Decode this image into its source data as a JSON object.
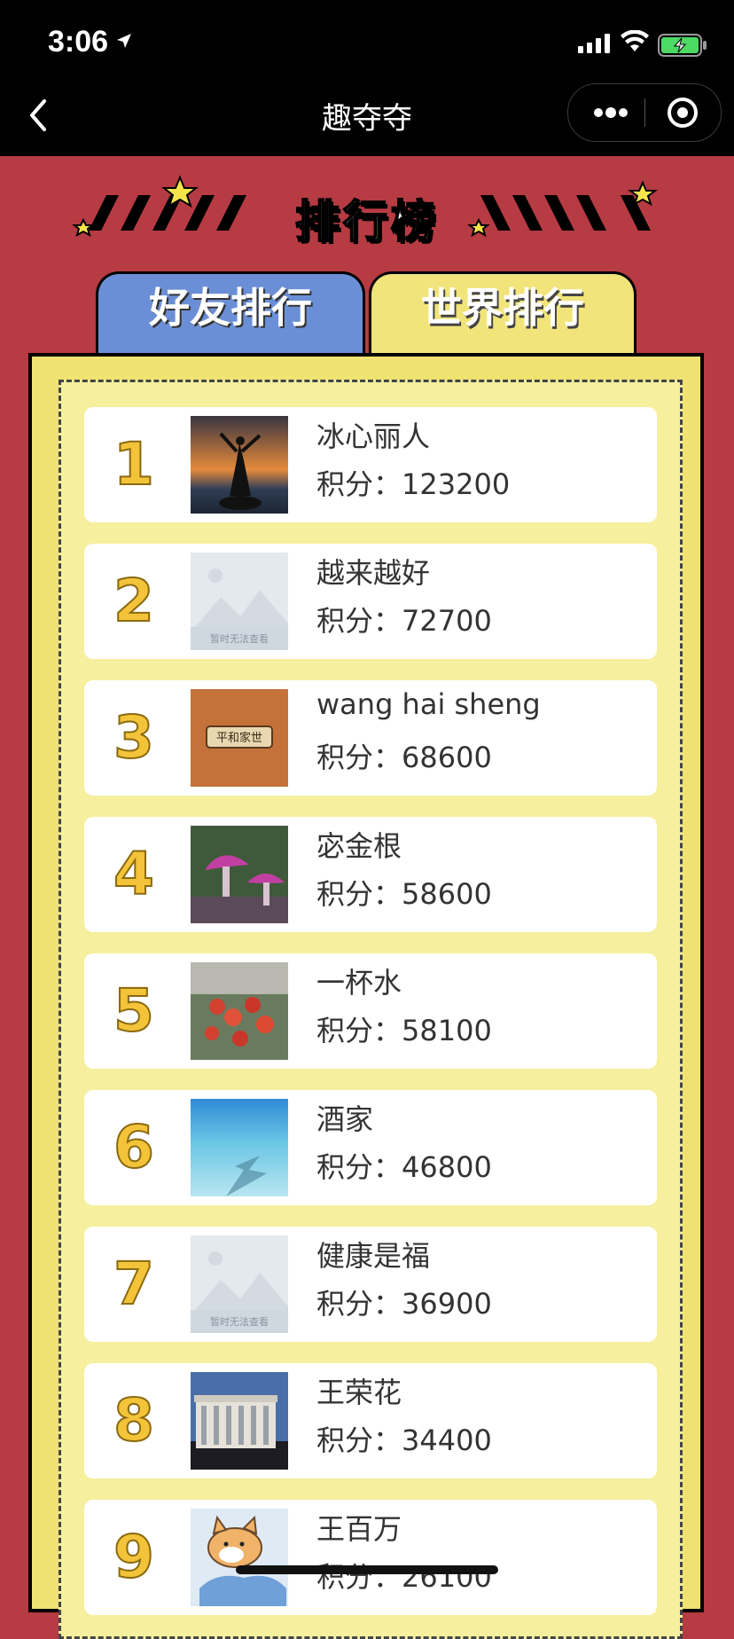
{
  "status": {
    "time": "3:06"
  },
  "nav": {
    "title": "趣夺夺"
  },
  "banner": {
    "title": "排行榜"
  },
  "tabs": {
    "friends": "好友排行",
    "world": "世界排行",
    "active": "world"
  },
  "score_label": "积分：",
  "colors": {
    "page_bg": "#b63b43",
    "board_bg": "#f0e272",
    "tab_friends": "#6b8fd6",
    "tab_world": "#f1e47a",
    "rank_gold": "#f3c33a"
  },
  "leaderboard": [
    {
      "rank": "1",
      "name": "冰心丽人",
      "score": "123200",
      "avatar": "sunset-dancer"
    },
    {
      "rank": "2",
      "name": "越来越好",
      "score": "72700",
      "avatar": "placeholder",
      "placeholder_text": "暂时无法查看"
    },
    {
      "rank": "3",
      "name": "wang hai sheng",
      "score": "68600",
      "avatar": "calligraphy-plaque",
      "avatar_text": "平和家世"
    },
    {
      "rank": "4",
      "name": "宓金根",
      "score": "58600",
      "avatar": "mushrooms"
    },
    {
      "rank": "5",
      "name": "一杯水",
      "score": "58100",
      "avatar": "red-berries"
    },
    {
      "rank": "6",
      "name": "酒家",
      "score": "46800",
      "avatar": "beach"
    },
    {
      "rank": "7",
      "name": "健康是福",
      "score": "36900",
      "avatar": "placeholder",
      "placeholder_text": "暂时无法查看"
    },
    {
      "rank": "8",
      "name": "王荣花",
      "score": "34400",
      "avatar": "building"
    },
    {
      "rank": "9",
      "name": "王百万",
      "score": "26100",
      "avatar": "cartoon-cat"
    }
  ]
}
